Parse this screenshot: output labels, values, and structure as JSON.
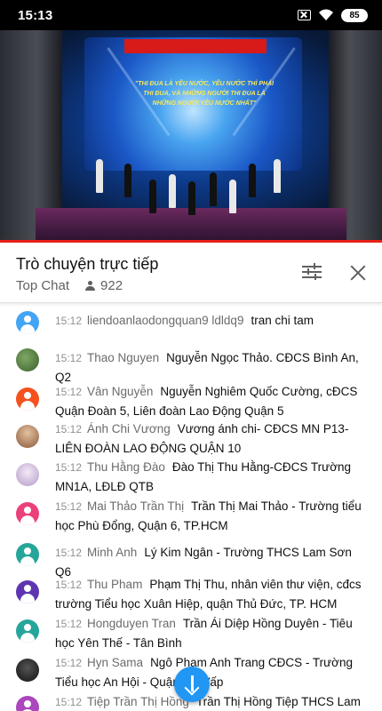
{
  "status_bar": {
    "time": "15:13",
    "battery": "85"
  },
  "video": {
    "slogan": "\"THI ĐUA LÀ YÊU NƯỚC, YÊU NƯỚC THÌ PHẢI THI ĐUA, VÀ NHỮNG NGƯỜI THI ĐUA LÀ NHỮNG NGƯỜI YÊU NƯỚC NHẤT\""
  },
  "chat": {
    "title": "Trò chuyện trực tiếp",
    "mode": "Top Chat",
    "viewer_count": "922"
  },
  "messages": [
    {
      "time": "15:12",
      "author": "liendoanlaodongquan9 ldldq9",
      "text": "tran chi tam",
      "avatar_color": "#42a5f5",
      "avatar_type": "generic"
    },
    {
      "time": "15:12",
      "author": "Thao Nguyen",
      "text": "Nguyễn Ngọc Thảo. CĐCS Bình An, Q2",
      "avatar_color": "#4a7a3a",
      "avatar_type": "photo"
    },
    {
      "time": "15:12",
      "author": "Vân Nguyễn",
      "text": "Nguyễn Nghiêm Quốc Cường, cĐCS Quận Đoàn 5, Liên đoàn Lao Động Quận 5",
      "avatar_color": "#f4511e",
      "avatar_type": "generic"
    },
    {
      "time": "15:12",
      "author": "Ánh Chi Vương",
      "text": "Vương ánh chi- CĐCS MN P13- LIÊN ĐOÀN LAO ĐỘNG QUẬN 10",
      "avatar_color": "#b07a55",
      "avatar_type": "photo"
    },
    {
      "time": "15:12",
      "author": "Thu Hằng Đào",
      "text": "Đào Thị Thu Hằng-CĐCS Trường MN1A, LĐLĐ QTB",
      "avatar_color": "#c9b6d8",
      "avatar_type": "photo"
    },
    {
      "time": "15:12",
      "author": "Mai Thảo Trần Thị",
      "text": "Trần Thị Mai Thảo - Trường tiểu học Phù Đổng, Quận 6, TP.HCM",
      "avatar_color": "#ec407a",
      "avatar_type": "generic"
    },
    {
      "time": "15:12",
      "author": "Minh Anh",
      "text": "Lý Kim Ngân - Trường THCS Lam Sơn Q6",
      "avatar_color": "#26a69a",
      "avatar_type": "generic"
    },
    {
      "time": "15:12",
      "author": "Thu Pham",
      "text": "Phạm Thị Thu, nhân viên thư viện, cđcs trường Tiểu học Xuân Hiệp, quận Thủ Đức, TP. HCM",
      "avatar_color": "#5e35b1",
      "avatar_type": "generic"
    },
    {
      "time": "15:12",
      "author": "Hongduyen Tran",
      "text": "Trần Ái Diệp Hồng Duyên - Tiêu học Yên Thế - Tân Bình",
      "avatar_color": "#26a69a",
      "avatar_type": "generic"
    },
    {
      "time": "15:12",
      "author": "Hyn Sama",
      "text": "Ngô Phạm Anh Trang CĐCS - Trường Tiểu học An Hội - Quận Gò Vấp",
      "avatar_color": "#222222",
      "avatar_type": "photo"
    },
    {
      "time": "15:12",
      "author": "Tiệp Trần Thị Hồng",
      "text": "Trần Thị Hồng Tiệp THCS Lam",
      "avatar_color": "#ab47bc",
      "avatar_type": "generic"
    }
  ]
}
